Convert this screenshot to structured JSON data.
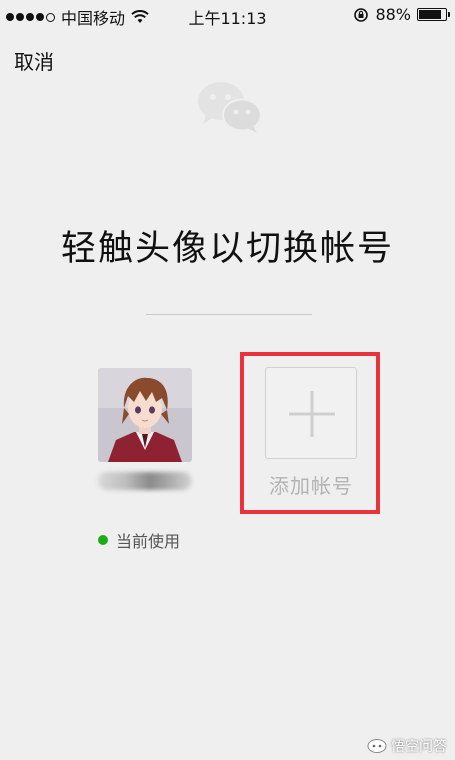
{
  "status_bar": {
    "carrier": "中国移动",
    "time": "上午11:13",
    "battery_percent": "88%",
    "battery_level": 0.88
  },
  "header": {
    "cancel_label": "取消"
  },
  "main": {
    "headline": "轻触头像以切换帐号",
    "current_account": {
      "status_label": "当前使用"
    },
    "add_account": {
      "label": "添加帐号"
    }
  },
  "colors": {
    "highlight": "#e8323c",
    "status_green": "#1aad19",
    "background": "#efefef"
  },
  "watermark": {
    "text": "悟空问答"
  }
}
